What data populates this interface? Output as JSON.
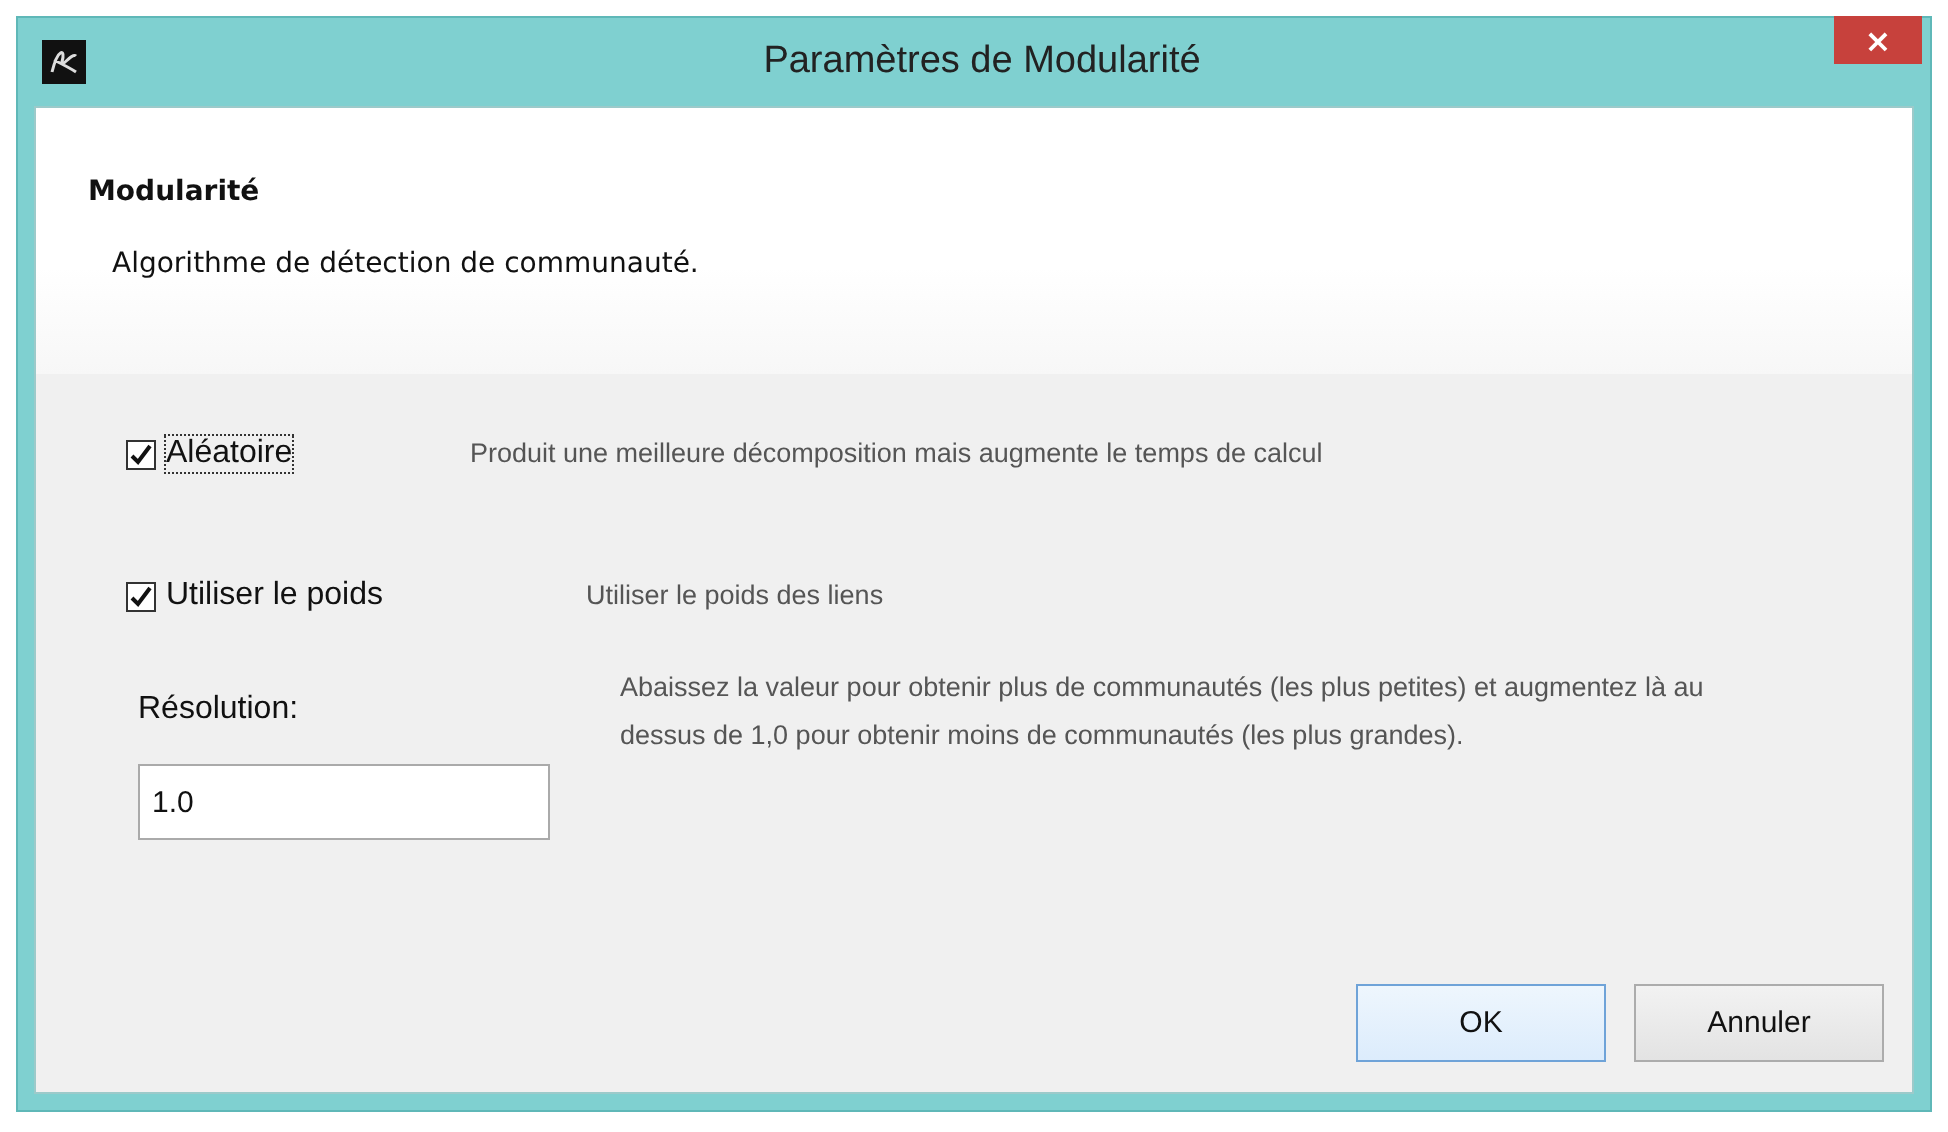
{
  "window": {
    "title": "Paramètres de Modularité",
    "close": "×"
  },
  "header": {
    "title": "Modularité",
    "description": "Algorithme de détection de communauté."
  },
  "options": [
    {
      "label": "Aléatoire",
      "checked": true,
      "focused": true,
      "description": "Produit une meilleure décomposition mais augmente le temps de calcul"
    },
    {
      "label": "Utiliser le poids",
      "checked": true,
      "focused": false,
      "description": "Utiliser le poids des liens"
    }
  ],
  "resolution": {
    "label": "Résolution:",
    "value": "1.0",
    "description": "Abaissez la valeur pour obtenir plus de communautés (les plus petites) et augmentez là au dessus de 1,0 pour obtenir moins de communautés (les plus grandes)."
  },
  "buttons": [
    {
      "label": "OK",
      "default": true
    },
    {
      "label": "Annuler",
      "default": false
    }
  ]
}
